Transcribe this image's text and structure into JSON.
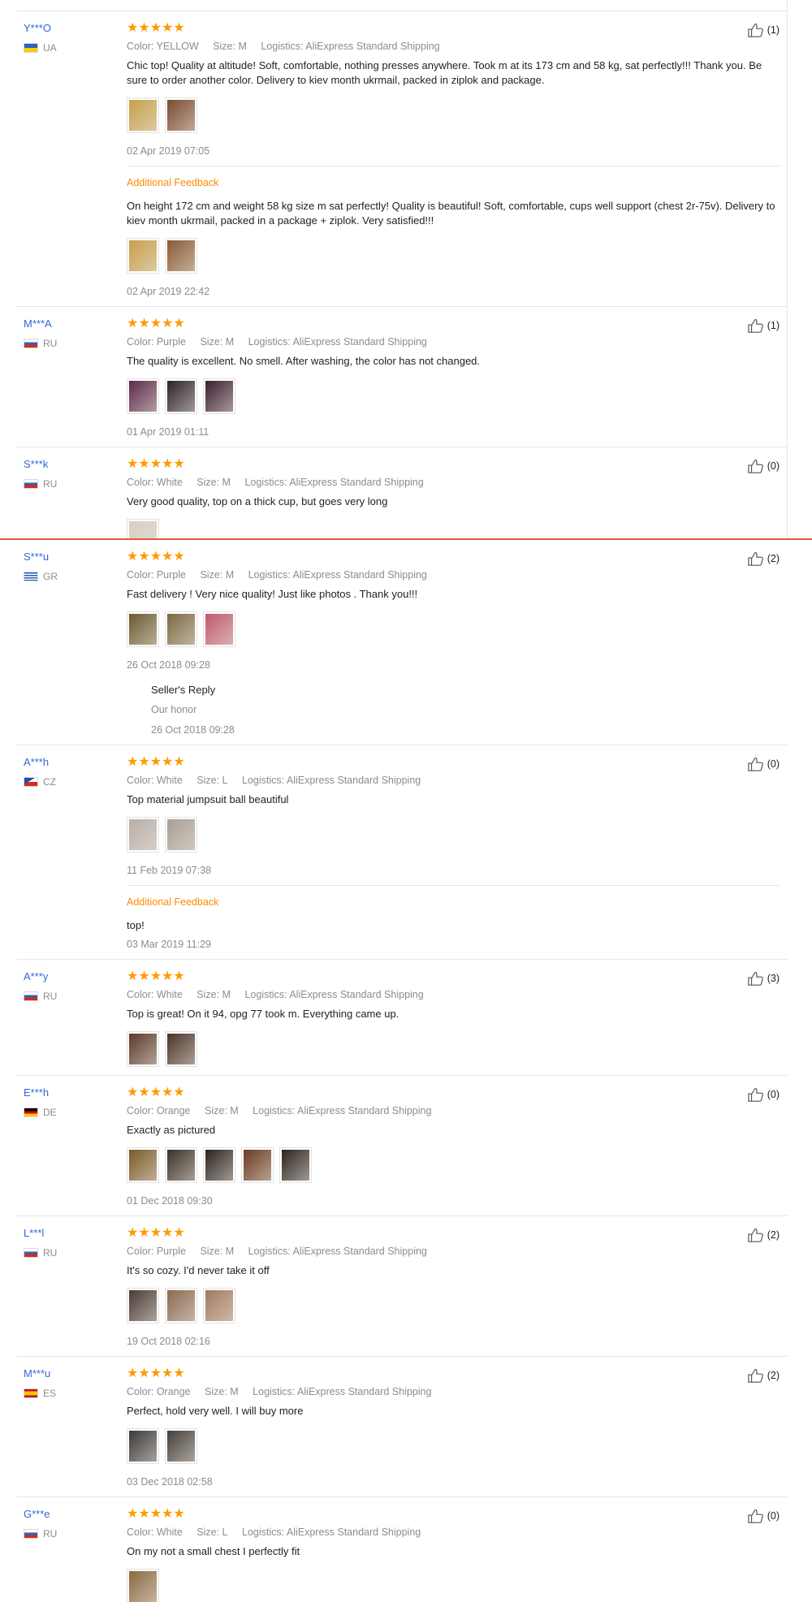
{
  "top_section": {
    "reviews": [
      {
        "user": "Y***O",
        "country": "UA",
        "flag": [
          "#2f5fbf",
          "#f4d200"
        ],
        "stars": "★★★★★",
        "helpful": "(1)",
        "color": "Color: YELLOW",
        "size": "Size: M",
        "logistics": "Logistics: AliExpress Standard Shipping",
        "text": "Chic top! Quality at altitude! Soft, comfortable, nothing presses anywhere. Took m at its 173 cm and 58 kg, sat perfectly!!! Thank you. Be sure to order another color. Delivery to kiev month ukrmail, packed in ziplok and package.",
        "photos": [
          "#c8a04a",
          "#7a4a30"
        ],
        "date": "02 Apr 2019 07:05",
        "additional": {
          "label": "Additional Feedback",
          "text": "On height 172 cm and weight 58 kg size m sat perfectly! Quality is beautiful! Soft, comfortable, cups well support (chest 2r-75v). Delivery to kiev month ukrmail, packed in a package + ziplok. Very satisfied!!!",
          "photos": [
            "#c8a04a",
            "#8a5a34"
          ],
          "date": "02 Apr 2019 22:42"
        }
      },
      {
        "user": "M***A",
        "country": "RU",
        "flag": [
          "#ffffff",
          "#2f5fbf",
          "#d52b1e"
        ],
        "stars": "★★★★★",
        "helpful": "(1)",
        "color": "Color: Purple",
        "size": "Size: M",
        "logistics": "Logistics: AliExpress Standard Shipping",
        "text": "The quality is excellent. No smell. After washing, the color has not changed.",
        "photos": [
          "#5a2a4a",
          "#2a2228",
          "#3a2030"
        ],
        "date": "01 Apr 2019 01:11"
      },
      {
        "user": "S***k",
        "country": "RU",
        "flag": [
          "#ffffff",
          "#2f5fbf",
          "#d52b1e"
        ],
        "stars": "★★★★★",
        "helpful": "(0)",
        "color": "Color: White",
        "size": "Size: M",
        "logistics": "Logistics: AliExpress Standard Shipping",
        "text": "Very good quality, top on a thick cup, but goes very long",
        "photos": [
          "#d8cfc4"
        ]
      }
    ]
  },
  "bottom_section": {
    "reviews": [
      {
        "user": "S***u",
        "country": "GR",
        "flag": [
          "#1f5fb8",
          "#ffffff"
        ],
        "stars": "★★★★★",
        "helpful": "(2)",
        "color": "Color: Purple",
        "size": "Size: M",
        "logistics": "Logistics: AliExpress Standard Shipping",
        "text": "Fast delivery ! Very nice quality! Just like photos . Thank you!!!",
        "photos": [
          "#6a5a30",
          "#7a6a40",
          "#c05a70"
        ],
        "date": "26 Oct 2018 09:28",
        "seller_reply": {
          "title": "Seller's Reply",
          "text": "Our honor",
          "date": "26 Oct 2018 09:28"
        }
      },
      {
        "user": "A***h",
        "country": "CZ",
        "flag": [
          "#ffffff",
          "#d52b1e",
          "#1f4fa0"
        ],
        "stars": "★★★★★",
        "helpful": "(0)",
        "color": "Color: White",
        "size": "Size: L",
        "logistics": "Logistics: AliExpress Standard Shipping",
        "text": "Top material jumpsuit ball beautiful",
        "photos": [
          "#b8b0a8",
          "#a89e94"
        ],
        "date": "11 Feb 2019 07:38",
        "additional": {
          "label": "Additional Feedback",
          "text": "top!",
          "date": "03 Mar 2019 11:29"
        }
      },
      {
        "user": "A***y",
        "country": "RU",
        "flag": [
          "#ffffff",
          "#2f5fbf",
          "#d52b1e"
        ],
        "stars": "★★★★★",
        "helpful": "(3)",
        "color": "Color: White",
        "size": "Size: M",
        "logistics": "Logistics: AliExpress Standard Shipping",
        "text": "Top is great! On it 94, opg 77 took m. Everything came up.",
        "photos": [
          "#5a3a2a",
          "#4a3228"
        ]
      },
      {
        "user": "E***h",
        "country": "DE",
        "flag": [
          "#000000",
          "#dd0000",
          "#ffce00"
        ],
        "stars": "★★★★★",
        "helpful": "(0)",
        "color": "Color: Orange",
        "size": "Size: M",
        "logistics": "Logistics: AliExpress Standard Shipping",
        "text": "Exactly as pictured",
        "photos": [
          "#7a5a28",
          "#3a3028",
          "#2a2420",
          "#6a3a20",
          "#2a2420"
        ],
        "date": "01 Dec 2018 09:30"
      },
      {
        "user": "L***l",
        "country": "RU",
        "flag": [
          "#ffffff",
          "#2f5fbf",
          "#d52b1e"
        ],
        "stars": "★★★★★",
        "helpful": "(2)",
        "color": "Color: Purple",
        "size": "Size: M",
        "logistics": "Logistics: AliExpress Standard Shipping",
        "text": "It's so cozy. I'd never take it off",
        "photos": [
          "#4a3a34",
          "#8a6a50",
          "#a07a60"
        ],
        "date": "19 Oct 2018 02:16"
      },
      {
        "user": "M***u",
        "country": "ES",
        "flag": [
          "#c60b1e",
          "#ffc400"
        ],
        "stars": "★★★★★",
        "helpful": "(2)",
        "color": "Color: Orange",
        "size": "Size: M",
        "logistics": "Logistics: AliExpress Standard Shipping",
        "text": "Perfect, hold very well. I will buy more",
        "photos": [
          "#3a3a38",
          "#44403c"
        ],
        "date": "03 Dec 2018 02:58"
      },
      {
        "user": "G***e",
        "country": "RU",
        "flag": [
          "#ffffff",
          "#2f5fbf",
          "#d52b1e"
        ],
        "stars": "★★★★★",
        "helpful": "(0)",
        "color": "Color: White",
        "size": "Size: L",
        "logistics": "Logistics: AliExpress Standard Shipping",
        "text": "On my not a small chest I perfectly fit",
        "photos": [
          "#8a6a40"
        ]
      }
    ]
  }
}
